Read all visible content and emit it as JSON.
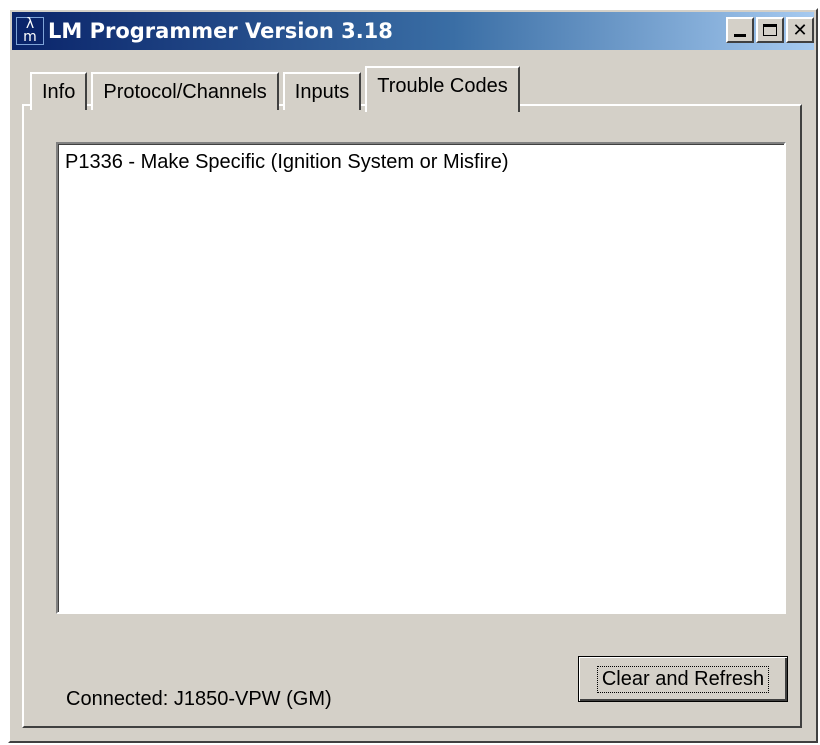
{
  "window": {
    "title": "LM Programmer Version 3.18",
    "app_icon": "λ-m-icon",
    "controls": [
      "minimize-icon",
      "maximize-icon",
      "close-icon"
    ]
  },
  "tabs": [
    {
      "label": "Info",
      "active": false
    },
    {
      "label": "Protocol/Channels",
      "active": false
    },
    {
      "label": "Inputs",
      "active": false
    },
    {
      "label": "Trouble Codes",
      "active": true
    }
  ],
  "trouble_codes": {
    "items": [
      "P1336 - Make Specific (Ignition System or Misfire)"
    ]
  },
  "status": {
    "connection": "Connected: J1850-VPW (GM)"
  },
  "buttons": {
    "clear_refresh": "Clear and Refresh"
  },
  "colors": {
    "title_gradient_start": "#0a246a",
    "title_gradient_end": "#a6caf0",
    "face": "#d4d0c8"
  }
}
